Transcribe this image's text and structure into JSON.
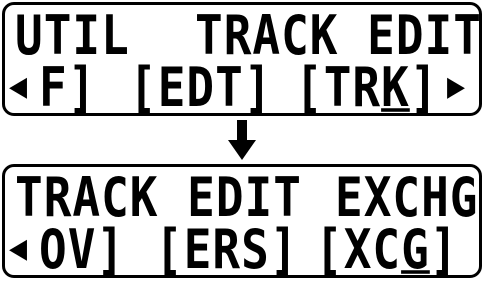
{
  "screen_before": {
    "title_line": {
      "left": "UTIL",
      "right": "TRACK EDIT"
    },
    "menu_line": {
      "left_arrow": "◀",
      "item1": "F]",
      "item2": "[EDT]",
      "item3_pre": "[TR",
      "item3_cursor": "K",
      "item3_post": "]",
      "right_arrow": "▶"
    }
  },
  "screen_after": {
    "title_line": {
      "left": "TRACK EDIT",
      "right": "EXCHG"
    },
    "menu_line": {
      "left_arrow": "◀",
      "item1": "OV]",
      "item2": "[ERS]",
      "item3_pre": "[XC",
      "item3_cursor": "G",
      "item3_post": "]"
    }
  },
  "transition_icon": "down-arrow-icon"
}
